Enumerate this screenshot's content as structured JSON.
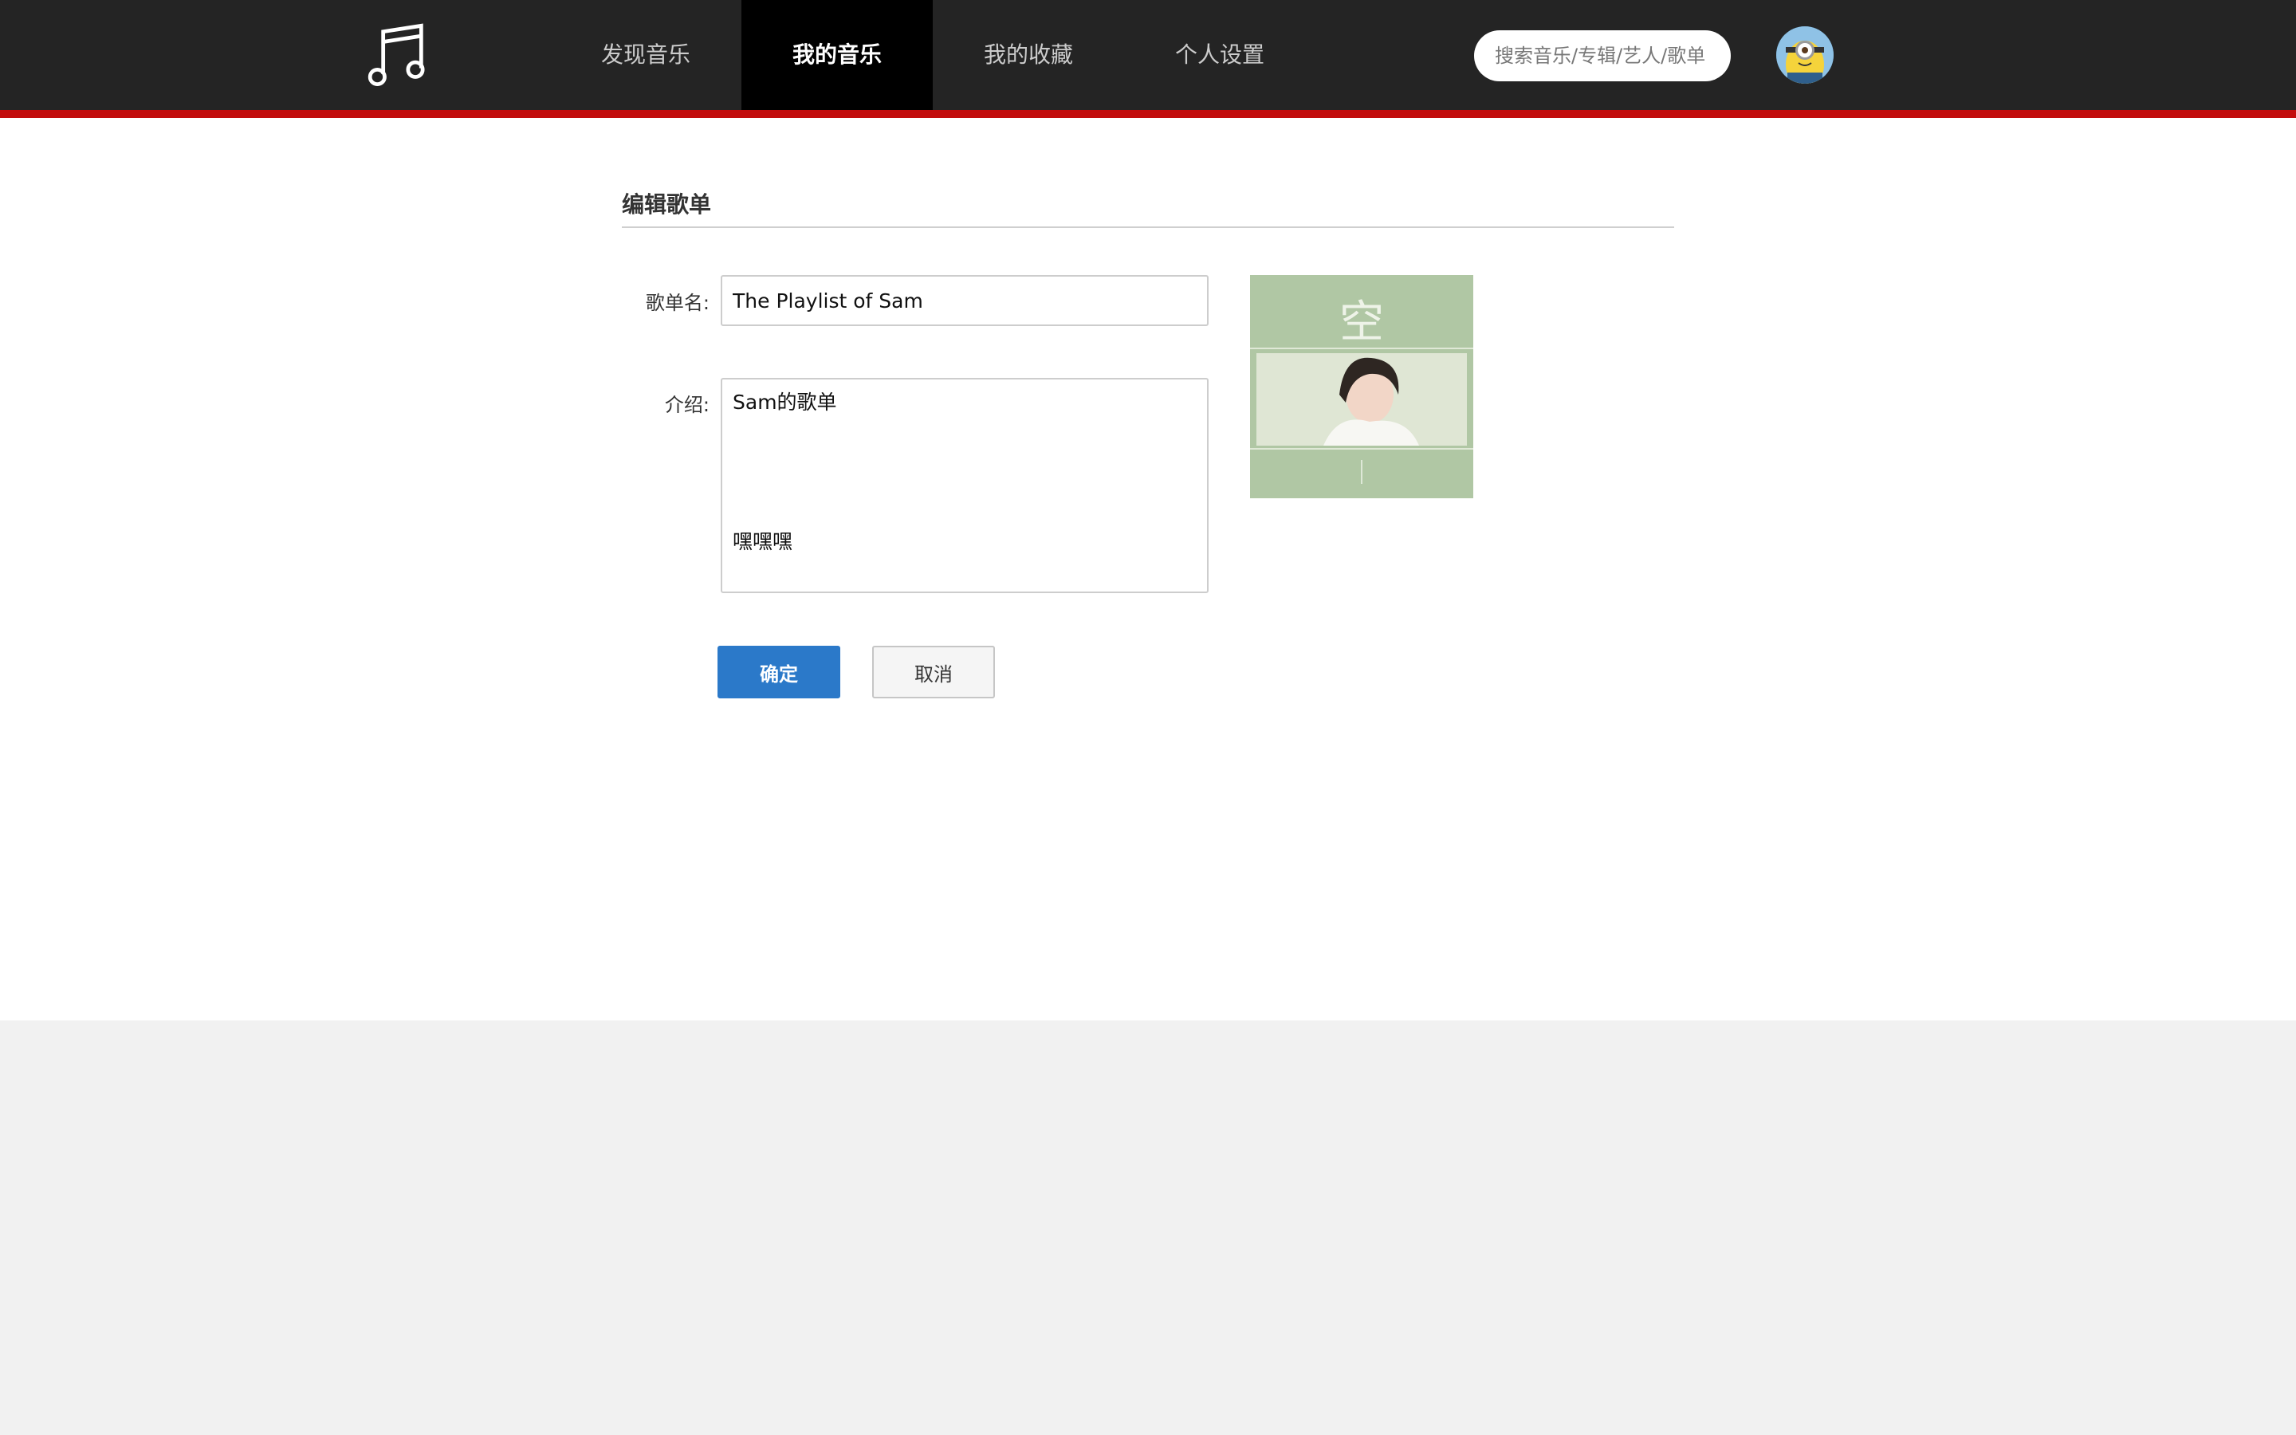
{
  "header": {
    "logo_icon": "music-note-icon",
    "nav": [
      {
        "label": "发现音乐",
        "active": false
      },
      {
        "label": "我的音乐",
        "active": true
      },
      {
        "label": "我的收藏",
        "active": false
      },
      {
        "label": "个人设置",
        "active": false
      }
    ],
    "search_placeholder": "搜索音乐/专辑/艺人/歌单",
    "avatar_icon": "minion-avatar-icon",
    "accent_color": "#c20c0c"
  },
  "editor": {
    "title": "编辑歌单",
    "name_label": "歌单名:",
    "name_value": "The Playlist of Sam",
    "desc_label": "介绍:",
    "desc_value": "Sam的歌单\n\n\n\n\n嘿嘿嘿",
    "cover_title": "空",
    "confirm_label": "确定",
    "cancel_label": "取消",
    "confirm_color": "#2b79c9"
  }
}
